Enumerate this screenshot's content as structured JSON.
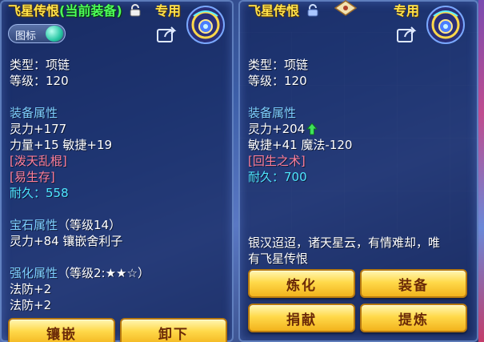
{
  "left_panel": {
    "title": "飞星传恨",
    "current_tag": "(当前装备)",
    "exclusive": "专用",
    "toggle_label": "图标",
    "type_line": "类型：项链",
    "level_line": "等级：120",
    "equip_attr_header": "装备属性",
    "attr_1": "灵力+177",
    "attr_2": "力量+15 敏捷+19",
    "special_1": "[泼天乱棍]",
    "special_2": "[易生存]",
    "durability": "耐久：558",
    "gem_header": "宝石属性",
    "gem_level": "（等级14）",
    "gem_attr": "灵力+84 镶嵌舍利子",
    "enhance_header": "强化属性",
    "enhance_level": "（等级2:★★☆）",
    "enhance_1": "法防+2",
    "enhance_2": "法防+2",
    "buttons": {
      "inlay": "镶嵌",
      "unequip": "卸下"
    }
  },
  "right_panel": {
    "title": "飞星传恨",
    "exclusive": "专用",
    "type_line": "类型：项链",
    "level_line": "等级：120",
    "equip_attr_header": "装备属性",
    "attr_1": "灵力+204",
    "attr_2": "敏捷+41 魔法-120",
    "special_1": "[回生之术]",
    "durability": "耐久：700",
    "description": "银汉迢迢，诸天星云，有情难却，唯有飞星传恨",
    "desc_line1": "银汉迢迢，诸天星云，有情难却，唯",
    "desc_line2": "有飞星传恨",
    "buttons": {
      "refine": "炼化",
      "equip": "装备",
      "donate": "捐献",
      "extract": "提炼"
    }
  },
  "colors": {
    "title_gold": "#ffe24a",
    "current_green": "#4cff5a",
    "header_blue": "#7fd0ff",
    "special_pink": "#ff7f9a",
    "durability_cyan": "#4fe6ff",
    "button_gold": "#ffd94a"
  },
  "icons": [
    "lock-icon",
    "share-icon",
    "necklace-item-icon",
    "up-arrow-icon",
    "appraise-badge-icon"
  ]
}
